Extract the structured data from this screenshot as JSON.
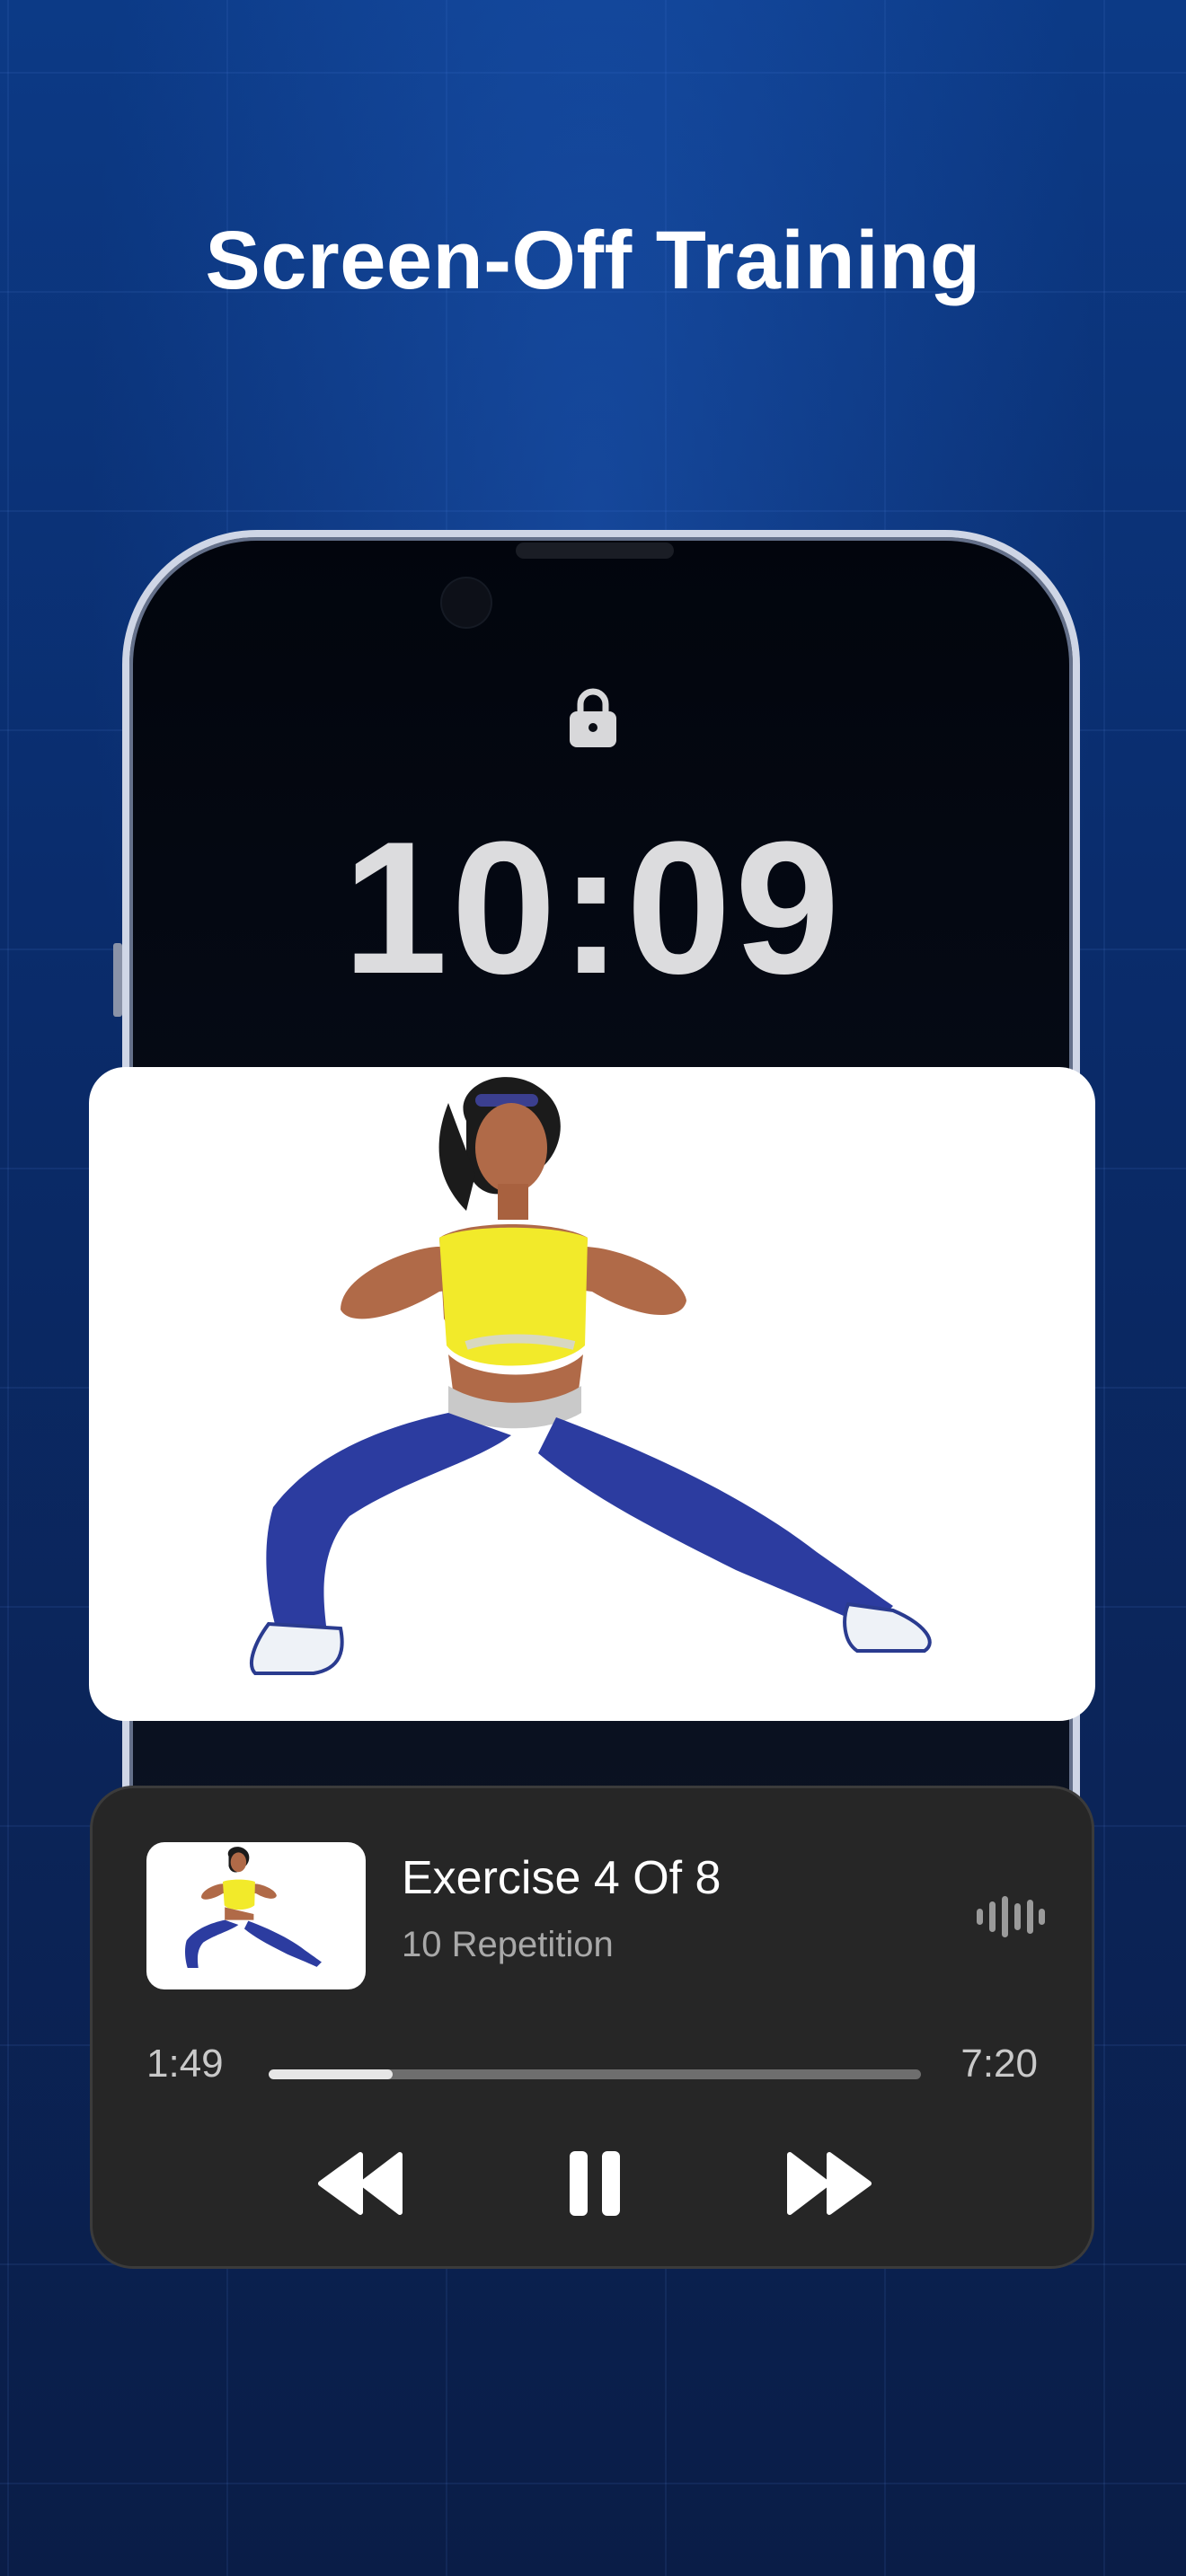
{
  "headline": "Screen-Off Training",
  "lock_screen": {
    "lock_icon": "lock-icon",
    "time": "10:09"
  },
  "exercise_preview": {
    "image": "woman-side-lunge-illustration"
  },
  "player": {
    "title": "Exercise 4 Of 8",
    "subtitle": "10 Repetition",
    "audio_icon": "audio-wave-icon",
    "current_time": "1:49",
    "total_time": "7:20",
    "progress": 0.19,
    "controls": [
      "rewind-icon",
      "pause-icon",
      "fast-forward-icon"
    ]
  },
  "colors": {
    "background": "#0b2a66",
    "player_bg": "#262626",
    "progress_track": "#6e6e6e",
    "progress_fill": "#e6e6e6"
  }
}
